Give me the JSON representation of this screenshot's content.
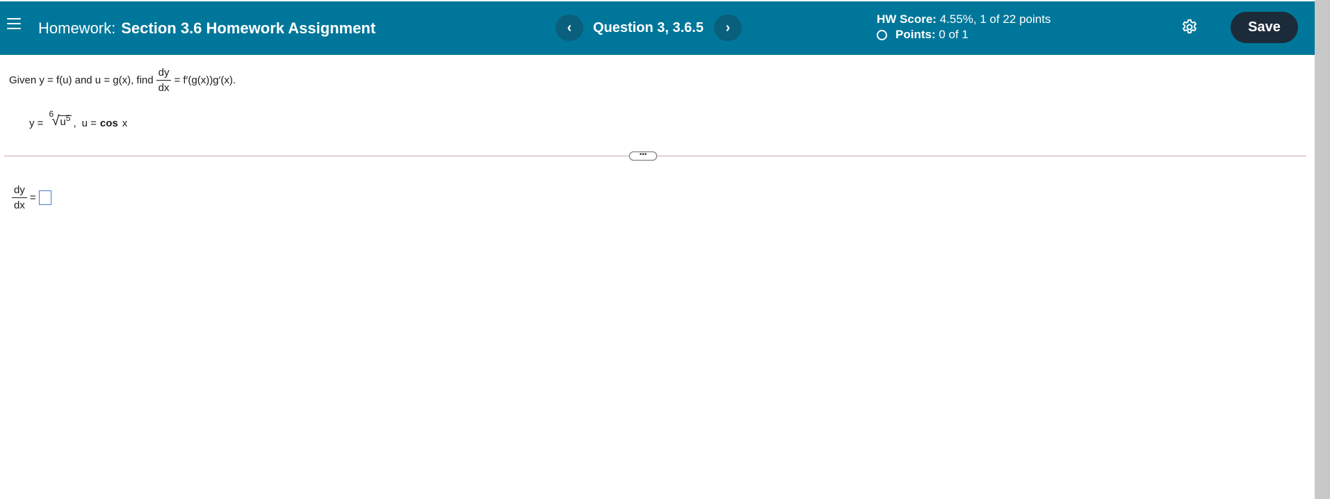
{
  "header": {
    "menu_icon": "hamburger-menu-icon",
    "homework_prefix": "Homework:",
    "assignment_name": "Section 3.6 Homework Assignment",
    "prev_label": "‹",
    "next_label": "›",
    "question_label": "Question 3, 3.6.5",
    "hw_score_label": "HW Score:",
    "hw_score_value": "4.55%, 1 of 22 points",
    "points_label": "Points:",
    "points_value": "0 of 1",
    "settings_icon": "gear-icon",
    "save_label": "Save"
  },
  "question": {
    "given_prefix": "Given y = f(u) and u = g(x), find",
    "frac_num": "dy",
    "frac_den": "dx",
    "given_suffix": "= f′(g(x))g′(x).",
    "y_eq": "y =",
    "root_index": "6",
    "radicand_base": "u",
    "radicand_exp": "5",
    "comma": ",",
    "u_eq": "u =",
    "cos_label": "cos",
    "cos_var": "x"
  },
  "divider": {
    "handle_label": "•••"
  },
  "answer": {
    "frac_num": "dy",
    "frac_den": "dx",
    "equals": "="
  },
  "colors": {
    "header_bg": "#00779a",
    "nav_btn_bg": "#0a5f7c",
    "save_bg": "#1b2b3a",
    "divider": "#c9a3ad",
    "answer_box_border": "#4a78c6"
  }
}
